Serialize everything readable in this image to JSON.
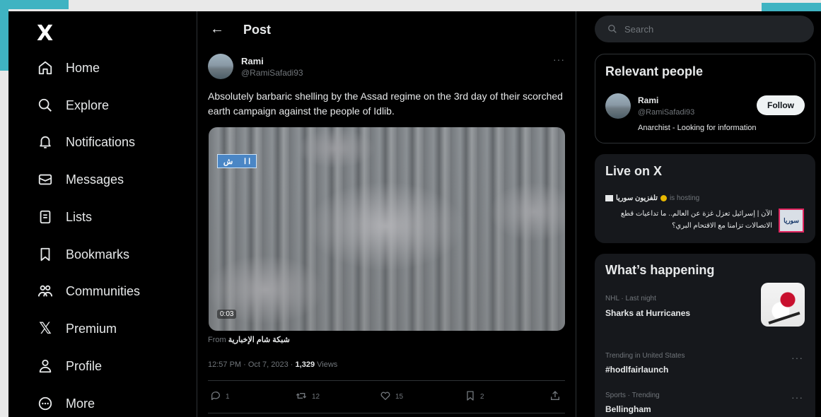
{
  "colors": {
    "accent": "#3fb3c2",
    "background": "#000000",
    "text": "#e7e9ea",
    "muted": "#71767b",
    "border": "#2f3336",
    "live_thumb_border": "#e0245e"
  },
  "nav": {
    "logo": "X",
    "items": [
      {
        "label": "Home",
        "icon": "home-icon"
      },
      {
        "label": "Explore",
        "icon": "search-icon"
      },
      {
        "label": "Notifications",
        "icon": "bell-icon"
      },
      {
        "label": "Messages",
        "icon": "envelope-icon"
      },
      {
        "label": "Lists",
        "icon": "list-icon"
      },
      {
        "label": "Bookmarks",
        "icon": "bookmark-icon"
      },
      {
        "label": "Communities",
        "icon": "communities-icon"
      },
      {
        "label": "Premium",
        "icon": "x-logo-icon"
      },
      {
        "label": "Profile",
        "icon": "person-icon"
      },
      {
        "label": "More",
        "icon": "more-circle-icon"
      }
    ]
  },
  "header": {
    "back_icon": "arrow-left-icon",
    "title": "Post"
  },
  "post": {
    "author_name": "Rami",
    "author_handle": "@RamiSafadi93",
    "text": "Absolutely barbaric shelling by the Assad regime on the 3rd day of their scorched earth campaign against the people of Idlib.",
    "media_badge_left": "ش",
    "media_badge_right": "ا ا",
    "media_time": "0:03",
    "from_prefix": "From",
    "from_source": "شبكة شام الإخبارية",
    "timestamp": "12:57 PM · Oct 7, 2023",
    "views_count": "1,329",
    "views_label": "Views",
    "actions": [
      {
        "icon": "reply-icon",
        "count": "1"
      },
      {
        "icon": "repost-icon",
        "count": "12"
      },
      {
        "icon": "like-icon",
        "count": "15"
      },
      {
        "icon": "bookmark-icon",
        "count": "2"
      },
      {
        "icon": "share-icon",
        "count": ""
      }
    ]
  },
  "sidebar": {
    "search_placeholder": "Search",
    "relevant_people": {
      "title": "Relevant people",
      "name": "Rami",
      "handle": "@RamiSafadi93",
      "bio": "Anarchist - Looking for information",
      "follow_label": "Follow"
    },
    "live": {
      "title": "Live on X",
      "host": "تلفزيون سوريا",
      "hosting_label": "is hosting",
      "line1": "الآن | إسرائيل تعزل غزة عن العالم.. ما تداعيات قطع",
      "line2": "الاتصالات تزامنا مع الاقتحام البري؟",
      "thumb_text": "سوريا"
    },
    "happening": {
      "title": "What’s happening",
      "items": [
        {
          "meta": "NHL · Last night",
          "title": "Sharks at Hurricanes"
        },
        {
          "meta": "Trending in United States",
          "title": "#hodlfairlaunch"
        },
        {
          "meta": "Sports · Trending",
          "title": "Bellingham"
        }
      ]
    }
  }
}
